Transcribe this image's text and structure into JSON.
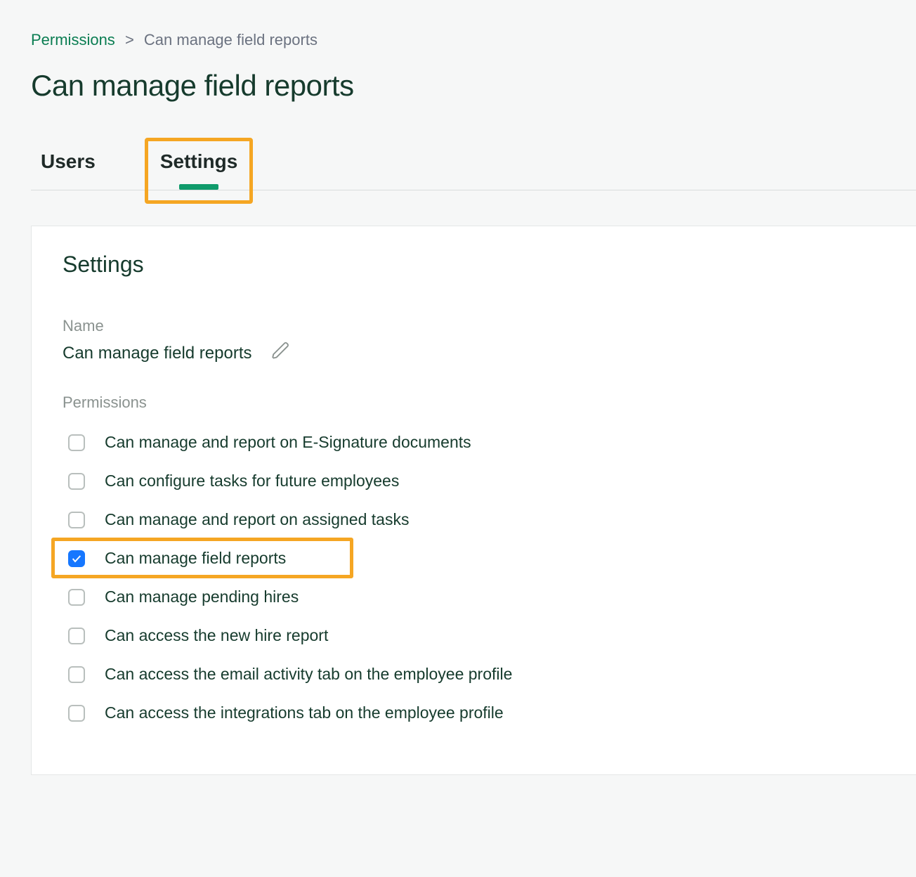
{
  "breadcrumb": {
    "root": "Permissions",
    "separator": ">",
    "current": "Can manage field reports"
  },
  "page_title": "Can manage field reports",
  "tabs": {
    "users": "Users",
    "settings": "Settings"
  },
  "panel": {
    "heading": "Settings",
    "name_label": "Name",
    "name_value": "Can manage field reports",
    "permissions_label": "Permissions",
    "permissions": [
      {
        "label": "Can manage and report on E-Signature documents",
        "checked": false
      },
      {
        "label": "Can configure tasks for future employees",
        "checked": false
      },
      {
        "label": "Can manage and report on assigned tasks",
        "checked": false
      },
      {
        "label": "Can manage field reports",
        "checked": true,
        "highlighted": true
      },
      {
        "label": "Can manage pending hires",
        "checked": false
      },
      {
        "label": "Can access the new hire report",
        "checked": false
      },
      {
        "label": "Can access the email activity tab on the employee profile",
        "checked": false
      },
      {
        "label": "Can access the integrations tab on the employee profile",
        "checked": false
      }
    ]
  }
}
